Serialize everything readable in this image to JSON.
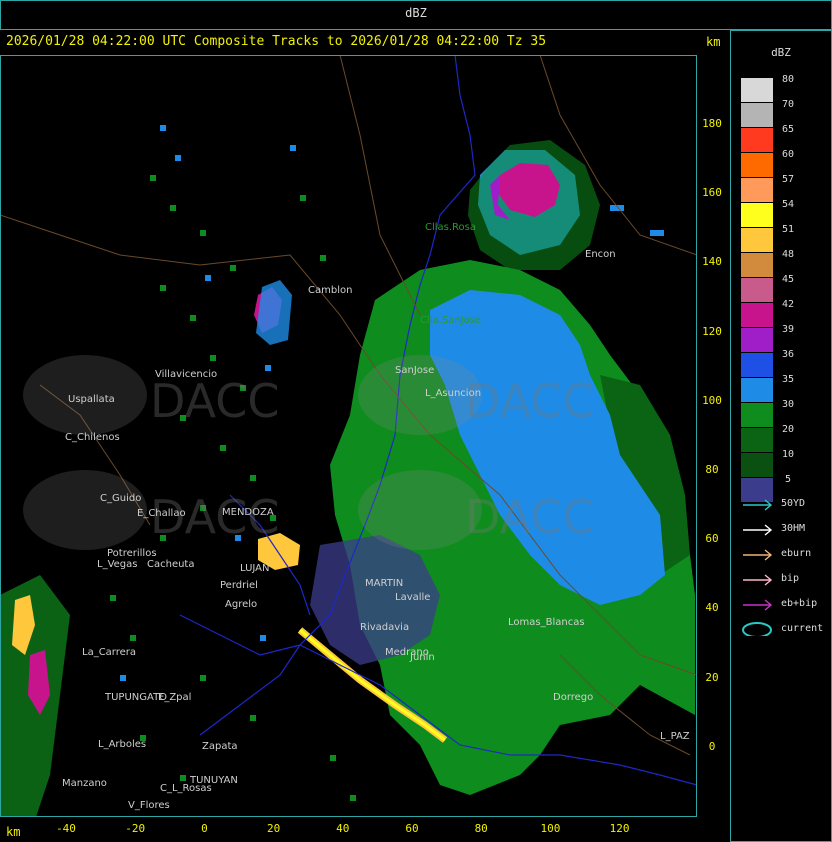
{
  "title_bar": {
    "product": "dBZ"
  },
  "header": {
    "text": "2026/01/28 04:22:00 UTC Composite Tracks to 2026/01/28 04:22:00 Tz 35",
    "unit_top": "km",
    "unit_bottom": "km"
  },
  "axes": {
    "y_ticks": [
      "180",
      "160",
      "140",
      "120",
      "100",
      "80",
      "60",
      "40",
      "20",
      "0"
    ],
    "x_ticks": [
      "-40",
      "-20",
      "0",
      "20",
      "40",
      "60",
      "80",
      "100",
      "120"
    ]
  },
  "legend": {
    "title": "dBZ",
    "scale": [
      {
        "label": "80",
        "color": "#d8d8d8"
      },
      {
        "label": "70",
        "color": "#b4b4b4"
      },
      {
        "label": "65",
        "color": "#ff3a1e"
      },
      {
        "label": "60",
        "color": "#ff6a00"
      },
      {
        "label": "57",
        "color": "#ff9a5a"
      },
      {
        "label": "54",
        "color": "#ffff1e"
      },
      {
        "label": "51",
        "color": "#ffc83c"
      },
      {
        "label": "48",
        "color": "#d28a3c"
      },
      {
        "label": "45",
        "color": "#c85a8c"
      },
      {
        "label": "42",
        "color": "#c8148c"
      },
      {
        "label": "39",
        "color": "#a01ec8"
      },
      {
        "label": "36",
        "color": "#1e50e6"
      },
      {
        "label": "35",
        "color": "#1e8ce6"
      },
      {
        "label": "30",
        "color": "#0f8c1e"
      },
      {
        "label": "20",
        "color": "#0a6414"
      },
      {
        "label": "10",
        "color": "#0a5010"
      },
      {
        "label": "5",
        "color": "#3c3c8c"
      }
    ],
    "tracks": [
      {
        "label": "50YD",
        "color": "#28c8c8"
      },
      {
        "label": "30HM",
        "color": "#ffffff"
      },
      {
        "label": "eburn",
        "color": "#f0b478"
      },
      {
        "label": "bip",
        "color": "#ffb4c8"
      },
      {
        "label": "eb+bip",
        "color": "#c832c8"
      },
      {
        "label": "current",
        "color": "#28c8c8"
      }
    ]
  },
  "map": {
    "places": [
      {
        "name": "Cllas.Rosa",
        "color": "#2a9a2a"
      },
      {
        "name": "Encon",
        "color": "#cfcfcf"
      },
      {
        "name": "Camblon",
        "color": "#cfcfcf"
      },
      {
        "name": "Clla.SanJose",
        "color": "#2a9a2a"
      },
      {
        "name": "Villavicencio",
        "color": "#cfcfcf"
      },
      {
        "name": "Uspallata",
        "color": "#cfcfcf"
      },
      {
        "name": "C_Chilenos",
        "color": "#cfcfcf"
      },
      {
        "name": "C_Guido",
        "color": "#cfcfcf"
      },
      {
        "name": "E_Challao",
        "color": "#cfcfcf"
      },
      {
        "name": "MENDOZA",
        "color": "#cfcfcf"
      },
      {
        "name": "Potrerillos",
        "color": "#cfcfcf"
      },
      {
        "name": "L_Vegas",
        "color": "#cfcfcf"
      },
      {
        "name": "Cacheuta",
        "color": "#cfcfcf"
      },
      {
        "name": "Perdriel",
        "color": "#cfcfcf"
      },
      {
        "name": "Agrelo",
        "color": "#cfcfcf"
      },
      {
        "name": "LUJAN",
        "color": "#cfcfcf"
      },
      {
        "name": "La_Carrera",
        "color": "#cfcfcf"
      },
      {
        "name": "TUPUNGATO",
        "color": "#cfcfcf"
      },
      {
        "name": "E_Zpal",
        "color": "#cfcfcf"
      },
      {
        "name": "L_Arboles",
        "color": "#cfcfcf"
      },
      {
        "name": "Zapata",
        "color": "#cfcfcf"
      },
      {
        "name": "TUNUYAN",
        "color": "#cfcfcf"
      },
      {
        "name": "Manzano",
        "color": "#cfcfcf"
      },
      {
        "name": "V_Flores",
        "color": "#cfcfcf"
      },
      {
        "name": "C_L_Rosas",
        "color": "#cfcfcf"
      },
      {
        "name": "MARTIN",
        "color": "#cfcfcf"
      },
      {
        "name": "Lomas_Blancas",
        "color": "#cfcfcf"
      },
      {
        "name": "Dorrego",
        "color": "#cfcfcf"
      },
      {
        "name": "L_PAZ",
        "color": "#cfcfcf"
      },
      {
        "name": "SanJose",
        "color": "#cfcfcf"
      },
      {
        "name": "L_Asuncion",
        "color": "#cfcfcf"
      },
      {
        "name": "Lavalle",
        "color": "#cfcfcf"
      },
      {
        "name": "Rivadavia",
        "color": "#cfcfcf"
      },
      {
        "name": "Medrano",
        "color": "#cfcfcf"
      },
      {
        "name": "Junin",
        "color": "#cfcfcf"
      }
    ],
    "watermark": "DACC"
  }
}
